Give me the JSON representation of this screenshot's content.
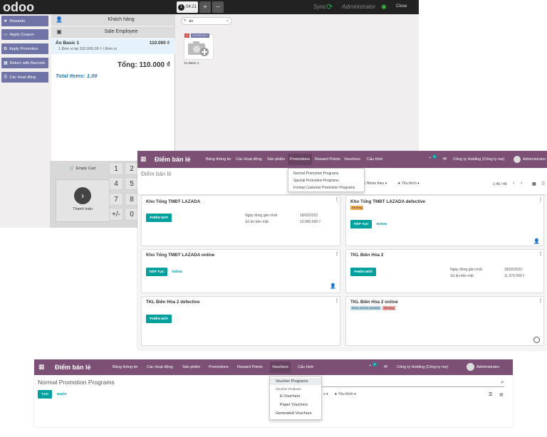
{
  "pos": {
    "logo": "odoo",
    "order_tab": {
      "number": "1",
      "time": "04:21"
    },
    "new_order_icon": "+",
    "delete_order_icon": "−",
    "sync_label": "Sync",
    "user_label": "Administrator",
    "close_label": "Close",
    "control_buttons": [
      {
        "label": "Rewards",
        "icon": "star-icon"
      },
      {
        "label": "Apply Coupon",
        "icon": "ticket-icon"
      },
      {
        "label": "Apply Promotion",
        "icon": "gift-icon"
      },
      {
        "label": "Return with Barcode",
        "icon": "barcode-icon"
      },
      {
        "label": "Các Hoạt động",
        "icon": "list-icon"
      }
    ],
    "customer_button": "Khách hàng",
    "employee_button": "Sale Employee",
    "order_line": {
      "name": "Áo Basic 1",
      "price": "110.000 ₫",
      "detail": "1 Đơn vị tại 110.000,00 ₫ / Đơn vị"
    },
    "total": "Tổng: 110.000 ₫",
    "total_items": "Total Items: 1.00",
    "search_value": "áo",
    "product": {
      "badge": "2",
      "price": "110.000,00 ₫",
      "name": "Áo Basic 1"
    },
    "empty_cart": "Empty Cart",
    "payment_label": "Thanh toán",
    "numpad_keys": [
      "1",
      "2",
      "4",
      "5",
      "7",
      "8",
      "+/-",
      "0"
    ]
  },
  "dashboard": {
    "brand": "Điểm bán lẻ",
    "menu": [
      "Bảng thông tin",
      "Các Hoạt động",
      "Sản phẩm",
      "Promotions",
      "Reward Points",
      "Vouchers",
      "Cấu hình"
    ],
    "active_menu": "Promotions",
    "chat_badge": "4",
    "company": "Công ty Holding (Công ty mẹ)",
    "user": "Administrator",
    "page_title": "Điểm bán lẻ",
    "dropdown": [
      "Normal Promotion Programs",
      "Special Promotion Programs",
      "Format Customer Promotion Programs"
    ],
    "group_by": "Nhóm theo",
    "favorites": "Yêu thích",
    "pager": "1-46 / 46",
    "cards": [
      {
        "title": "Kho Tổng TMĐT LAZADA",
        "button": "PHIÊN MỚI",
        "meta": [
          [
            "Ngày đóng gần nhất",
            "18/02/2022"
          ],
          [
            "Số dư tiền mặt",
            "10.960.000 ₫"
          ]
        ]
      },
      {
        "title": "Kho Tổng TMĐT LAZADA defective",
        "tag": "Đã đóng",
        "button": "TIẾP TỤC",
        "link": "ĐÓNG"
      },
      {
        "title": "Kho Tổng TMĐT LAZADA online",
        "button": "TIẾP TỤC",
        "link": "ĐÓNG"
      },
      {
        "title": "TKL Biên Hòa 2",
        "button": "PHIÊN MỚI",
        "meta": [
          [
            "Ngày đóng gần nhất",
            "18/02/2022"
          ],
          [
            "Số dư tiền mặt",
            "11.670.000 ₫"
          ]
        ]
      },
      {
        "title": "TKL Biên Hòa 2 defective",
        "button": "PHIÊN MỚI"
      },
      {
        "title": "TKL Biên Hòa 2 online",
        "tags": [
          "Được mở bởi OdooBot",
          "Đã đóng"
        ]
      }
    ]
  },
  "voucher_page": {
    "brand": "Điểm bán lẻ",
    "menu": [
      "Bảng thông tin",
      "Các Hoạt động",
      "Sản phẩm",
      "Promotions",
      "Reward Points",
      "Vouchers",
      "Cấu hình"
    ],
    "active_menu": "Vouchers",
    "chat_badge": "4",
    "company": "Công ty Holding (Công ty mẹ)",
    "user": "Administrator",
    "page_title": "Normal Promotion Programs",
    "create_button": "TẠO",
    "import_button": "NHẬP",
    "favorites": "Yêu thích",
    "dropdown": {
      "item1": "Voucher Programs",
      "section": "Voucher Products",
      "items": [
        "E-Vouchers",
        "Paper Vouchers",
        "Generated Vouchers"
      ]
    }
  },
  "colors": {
    "odoo_purple": "#7c4f74",
    "teal": "#00a09d",
    "pos_button": "#6f73a5"
  }
}
